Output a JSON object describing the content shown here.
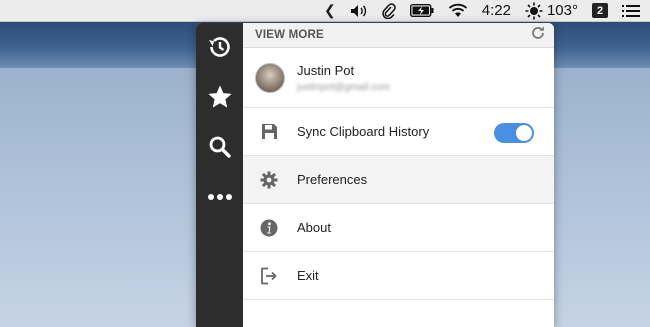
{
  "menubar": {
    "time": "4:22",
    "temperature": "103°",
    "badge": "2",
    "icons": [
      "chevron-left-icon",
      "volume-icon",
      "paperclip-icon",
      "battery-charging-icon",
      "wifi-icon",
      "weather-sun-icon",
      "list-icon"
    ]
  },
  "rail": {
    "items": [
      {
        "name": "history",
        "icon": "history-icon"
      },
      {
        "name": "favorites",
        "icon": "star-icon"
      },
      {
        "name": "search",
        "icon": "search-icon"
      },
      {
        "name": "more",
        "icon": "more-dots-icon"
      }
    ]
  },
  "panel": {
    "title": "VIEW MORE",
    "account": {
      "name": "Justin Pot",
      "email": "justinpot@gmail.com"
    },
    "menu": [
      {
        "label": "Sync Clipboard History",
        "icon": "floppy-disk-icon"
      },
      {
        "label": "Preferences",
        "icon": "gear-icon"
      },
      {
        "label": "About",
        "icon": "info-icon"
      },
      {
        "label": "Exit",
        "icon": "exit-icon"
      }
    ],
    "sync_enabled": true
  },
  "colors": {
    "accent": "#4a90e2",
    "rail": "#2d2d2d"
  }
}
